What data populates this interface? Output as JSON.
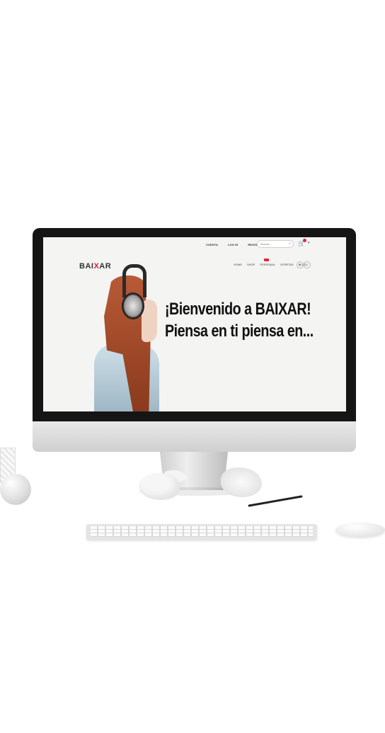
{
  "site": {
    "top_links": [
      "CUENTA",
      "LOG IN",
      "REGISTRAR"
    ],
    "search_placeholder": "Buscar...",
    "logo_prefix": "BAI",
    "logo_x": "X",
    "logo_suffix": "AR",
    "nav": [
      "HOME",
      "SHOP",
      "PERSONAL",
      "OFERTAS",
      "BLOG"
    ],
    "social": [
      "f",
      "☺"
    ],
    "hero_line1": "¡Bienvenido a BAIXAR!",
    "hero_line2": "Piensa en ti piensa en...",
    "accent_color": "#d3242c"
  }
}
